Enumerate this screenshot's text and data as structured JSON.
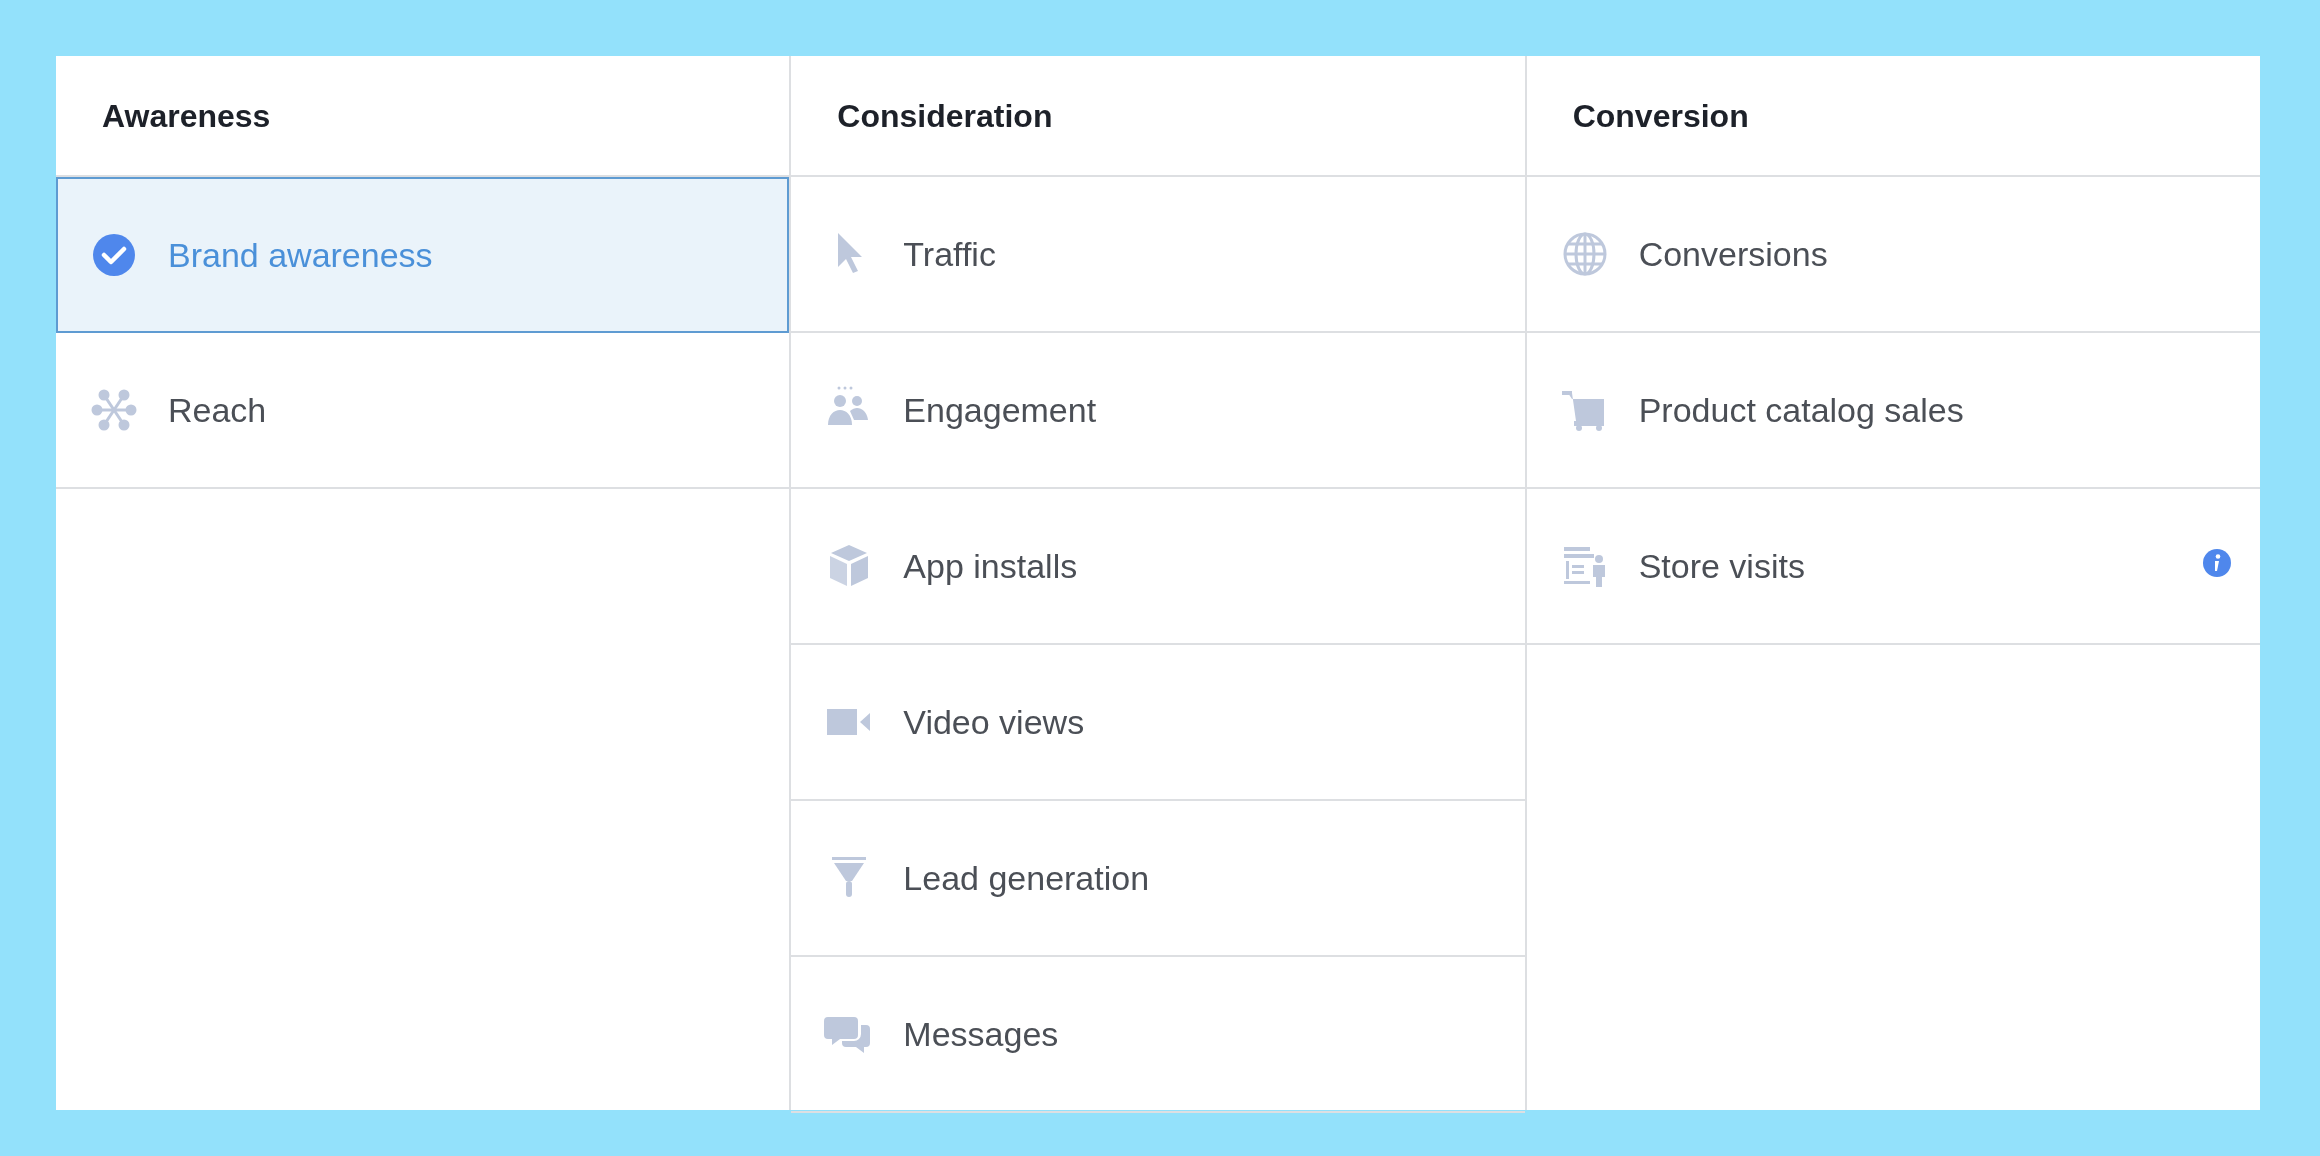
{
  "columns": [
    {
      "title": "Awareness",
      "items": [
        {
          "label": "Brand awareness",
          "selected": true,
          "info": false
        },
        {
          "label": "Reach",
          "kind": "reach",
          "selected": false,
          "info": false
        }
      ]
    },
    {
      "title": "Consideration",
      "items": [
        {
          "label": "Traffic",
          "kind": "cursor",
          "selected": false,
          "info": false
        },
        {
          "label": "Engagement",
          "kind": "people",
          "selected": false,
          "info": false
        },
        {
          "label": "App installs",
          "kind": "cube",
          "selected": false,
          "info": false
        },
        {
          "label": "Video views",
          "kind": "video",
          "selected": false,
          "info": false
        },
        {
          "label": "Lead generation",
          "kind": "funnel",
          "selected": false,
          "info": false
        },
        {
          "label": "Messages",
          "kind": "chat",
          "selected": false,
          "info": false
        }
      ]
    },
    {
      "title": "Conversion",
      "items": [
        {
          "label": "Conversions",
          "kind": "globe",
          "selected": false,
          "info": false
        },
        {
          "label": "Product catalog sales",
          "kind": "cart",
          "selected": false,
          "info": false
        },
        {
          "label": "Store visits",
          "kind": "store",
          "selected": false,
          "info": true
        }
      ]
    }
  ]
}
